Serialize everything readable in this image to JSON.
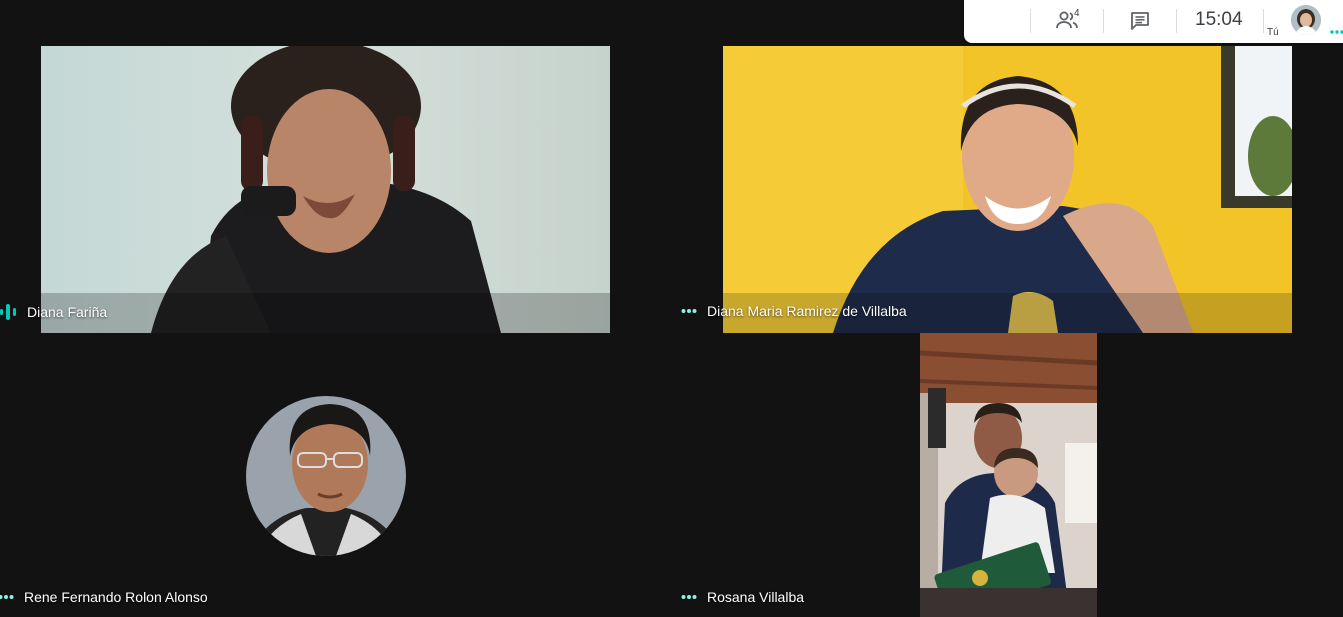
{
  "topbar": {
    "participants_count": "4",
    "time": "15:04",
    "self_label": "Tú"
  },
  "participants": [
    {
      "name": "Diana Fariña",
      "status": "speaking"
    },
    {
      "name": "Diana Maria Ramirez de Villalba",
      "status": "more-options"
    },
    {
      "name": "Rene Fernando Rolon Alonso",
      "status": "more-options"
    },
    {
      "name": "Rosana Villalba",
      "status": "more-options"
    }
  ],
  "colors": {
    "background": "#121212",
    "accent": "#00c9b7",
    "yellow_wall": "#f2c428"
  },
  "icons": [
    "people-icon",
    "chat-icon",
    "audio-level-icon",
    "more-options-icon"
  ]
}
